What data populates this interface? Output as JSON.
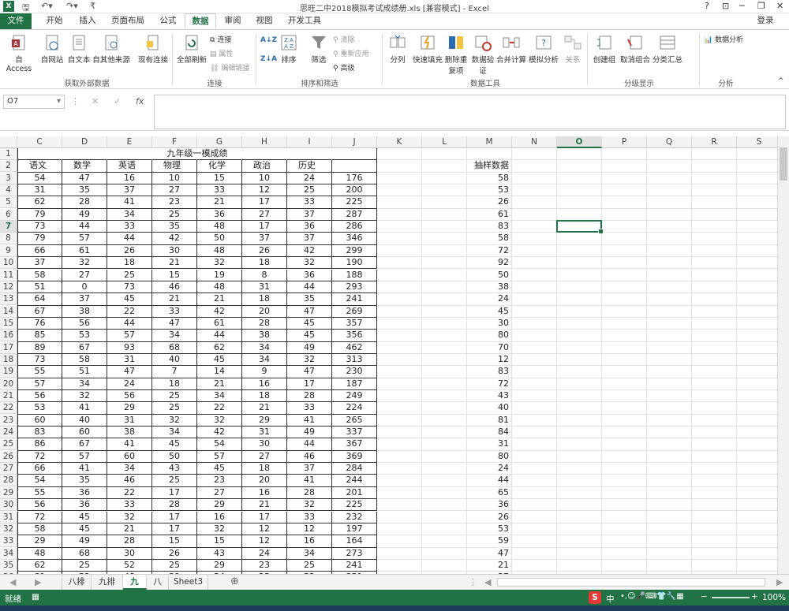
{
  "window": {
    "title": "思旺二中2018模拟考试成绩册.xls  [兼容模式] - Excel",
    "help": "?",
    "minimize": "─",
    "restore": "❐",
    "close": "✕",
    "login": "登录"
  },
  "quick_access": {
    "save_icon": "save-icon",
    "undo_icon": "undo-icon",
    "redo_icon": "redo-icon"
  },
  "ribbon_tabs": [
    "文件",
    "开始",
    "插入",
    "页面布局",
    "公式",
    "数据",
    "审阅",
    "视图",
    "开发工具"
  ],
  "ribbon": {
    "groups": [
      "获取外部数据",
      "连接",
      "排序和筛选",
      "数据工具",
      "分级显示",
      "分析"
    ],
    "get_data": [
      "自 Access",
      "自网站",
      "自文本",
      "自其他来源",
      "现有连接"
    ],
    "connections": {
      "refresh": "全部刷新",
      "conn": "连接",
      "props": "属性",
      "edit_links": "编辑链接"
    },
    "sort_filter": {
      "sort_az": "A↓Z",
      "sort_za": "Z↓A",
      "sort": "排序",
      "filter": "筛选",
      "clear": "清除",
      "reapply": "重新应用",
      "advanced": "高级"
    },
    "data_tools": [
      "分列",
      "快速填充",
      "删除重复项",
      "数据验证",
      "合并计算",
      "模拟分析",
      "关系"
    ],
    "outline": [
      "创建组",
      "取消组合",
      "分类汇总"
    ],
    "analysis": "数据分析"
  },
  "formula_bar": {
    "name_box": "O7",
    "cancel": "✕",
    "enter": "✓",
    "fx": "fx",
    "value": ""
  },
  "columns": [
    "C",
    "D",
    "E",
    "F",
    "G",
    "H",
    "I",
    "J",
    "K",
    "L",
    "M",
    "N",
    "O",
    "P",
    "Q",
    "R",
    "S"
  ],
  "selected_column": "O",
  "selected_row": 7,
  "sheet": {
    "title": "九年级一模成绩",
    "headers": [
      "语文",
      "数学",
      "英语",
      "物理",
      "化学",
      "政治",
      "历史",
      ""
    ],
    "sample_header": "抽样数据",
    "rows": [
      [
        54,
        47,
        16,
        10,
        15,
        10,
        24,
        176
      ],
      [
        31,
        35,
        37,
        27,
        33,
        12,
        25,
        200
      ],
      [
        62,
        28,
        41,
        23,
        21,
        17,
        33,
        225
      ],
      [
        79,
        49,
        34,
        25,
        36,
        27,
        37,
        287
      ],
      [
        73,
        44,
        33,
        35,
        48,
        17,
        36,
        286
      ],
      [
        79,
        57,
        44,
        42,
        50,
        37,
        37,
        346
      ],
      [
        66,
        61,
        26,
        30,
        48,
        26,
        42,
        299
      ],
      [
        37,
        32,
        18,
        21,
        32,
        18,
        32,
        190
      ],
      [
        58,
        27,
        25,
        15,
        19,
        8,
        36,
        188
      ],
      [
        51,
        0,
        73,
        46,
        48,
        31,
        44,
        293
      ],
      [
        64,
        37,
        45,
        21,
        21,
        18,
        35,
        241
      ],
      [
        67,
        38,
        22,
        33,
        42,
        20,
        47,
        269
      ],
      [
        76,
        56,
        44,
        47,
        61,
        28,
        45,
        357
      ],
      [
        85,
        53,
        57,
        34,
        44,
        38,
        45,
        356
      ],
      [
        89,
        67,
        93,
        68,
        62,
        34,
        49,
        462
      ],
      [
        73,
        58,
        31,
        40,
        45,
        34,
        32,
        313
      ],
      [
        55,
        51,
        47,
        7,
        14,
        9,
        47,
        230
      ],
      [
        57,
        34,
        24,
        18,
        21,
        16,
        17,
        187
      ],
      [
        56,
        32,
        56,
        25,
        34,
        18,
        28,
        249
      ],
      [
        53,
        41,
        29,
        25,
        22,
        21,
        33,
        224
      ],
      [
        60,
        40,
        31,
        32,
        32,
        29,
        41,
        265
      ],
      [
        83,
        60,
        38,
        34,
        42,
        31,
        49,
        337
      ],
      [
        86,
        67,
        41,
        45,
        54,
        30,
        44,
        367
      ],
      [
        72,
        57,
        60,
        50,
        57,
        27,
        46,
        369
      ],
      [
        66,
        41,
        34,
        43,
        45,
        18,
        37,
        284
      ],
      [
        54,
        35,
        46,
        25,
        23,
        20,
        41,
        244
      ],
      [
        55,
        36,
        22,
        17,
        27,
        16,
        28,
        201
      ],
      [
        56,
        36,
        33,
        28,
        29,
        21,
        32,
        225
      ],
      [
        72,
        45,
        32,
        17,
        16,
        17,
        33,
        232
      ],
      [
        58,
        45,
        21,
        17,
        32,
        12,
        12,
        197
      ],
      [
        29,
        49,
        28,
        15,
        15,
        12,
        16,
        164
      ],
      [
        48,
        68,
        30,
        26,
        43,
        24,
        34,
        273
      ],
      [
        62,
        25,
        52,
        25,
        29,
        23,
        25,
        241
      ],
      [
        81,
        52,
        48,
        39,
        54,
        25,
        52,
        351
      ]
    ],
    "samples": [
      58,
      53,
      26,
      61,
      83,
      58,
      72,
      92,
      50,
      38,
      24,
      45,
      30,
      80,
      70,
      12,
      83,
      72,
      43,
      40,
      81,
      84,
      31,
      80,
      24,
      44,
      65,
      36,
      26,
      53,
      59,
      47,
      21,
      37
    ]
  },
  "sheet_tabs": [
    "八排",
    "九排",
    "九",
    "八",
    "Sheet3"
  ],
  "active_sheet": "九",
  "status": {
    "ready": "就绪",
    "zoom": "100%",
    "ime": "中"
  }
}
